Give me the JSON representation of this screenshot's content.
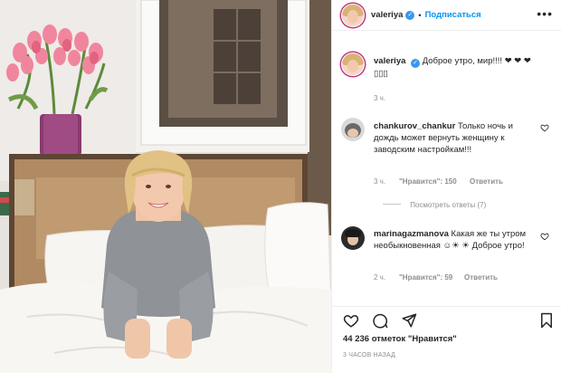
{
  "post": {
    "username": "valeriya",
    "follow_label": "Подписаться",
    "separator": "•",
    "more_label": "•••",
    "caption_text": "Доброе утро, мир!!!! ❤ ❤ ❤▯▯▯",
    "caption_time": "3 ч.",
    "likes": "44 236 отметок \"Нравится\"",
    "time_ago": "3 ЧАСОВ НАЗАД"
  },
  "comments": [
    {
      "username": "chankurov_chankur",
      "text": "Только ночь и дождь может вернуть женщину к заводским настройкам!!!",
      "time": "3 ч.",
      "likes": "\"Нравится\": 150",
      "reply_label": "Ответить",
      "view_replies": "Посмотреть ответы (7)"
    },
    {
      "username": "marinagazmanova",
      "text": "Какая же ты утром необыкновенная ☺☀ ☀ Доброе утро!",
      "time": "2 ч.",
      "likes": "\"Нравится\": 59",
      "reply_label": "Ответить"
    }
  ],
  "icons": {
    "heart": "heart-icon",
    "comment": "comment-icon",
    "share": "share-icon",
    "save": "bookmark-icon",
    "verified": "verified-badge-icon"
  },
  "colors": {
    "link": "#0095f6",
    "muted": "#8e8e8e",
    "verified": "#3897f0",
    "text": "#262626"
  }
}
